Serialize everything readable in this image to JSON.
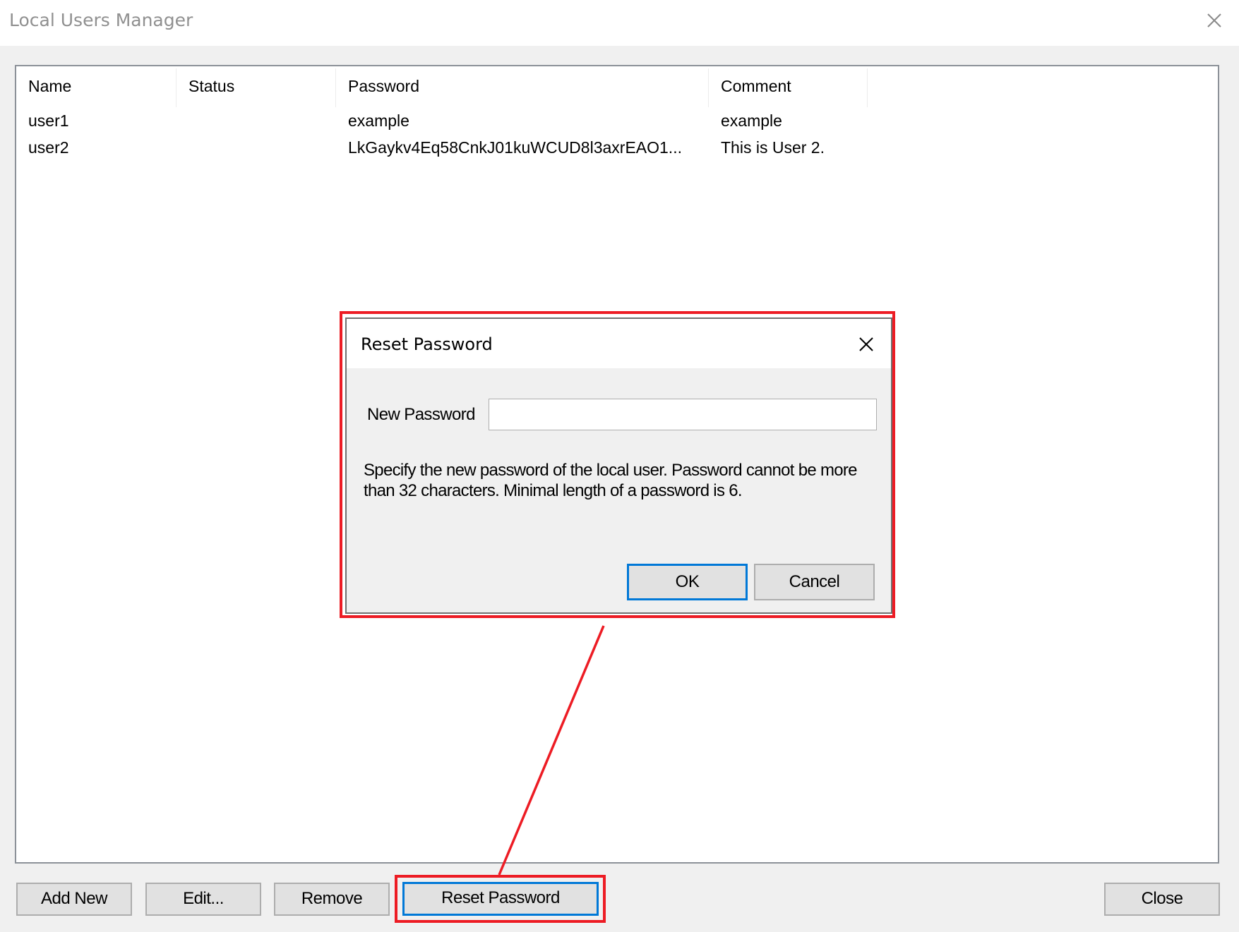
{
  "window": {
    "title": "Local Users Manager",
    "close_icon": "close-icon"
  },
  "users_list": {
    "columns": [
      "Name",
      "Status",
      "Password",
      "Comment"
    ],
    "rows": [
      {
        "name": "user1",
        "status": "",
        "password": "example",
        "comment": "example"
      },
      {
        "name": "user2",
        "status": "",
        "password": "LkGaykv4Eq58CnkJ01kuWCUD8l3axrEAO1...",
        "comment": "This is User 2."
      }
    ]
  },
  "buttons": {
    "add_new": "Add New",
    "edit": "Edit...",
    "remove": "Remove",
    "reset_password": "Reset Password",
    "close": "Close"
  },
  "reset_dialog": {
    "title": "Reset Password",
    "new_password_label": "New Password",
    "new_password_value": "",
    "help_text": "Specify the new password of the local user. Password cannot be more than 32 characters. Minimal length of a password is 6.",
    "ok": "OK",
    "cancel": "Cancel"
  },
  "annotation": {
    "highlight_color": "#ed1c24",
    "focus_color": "#0078d7"
  }
}
